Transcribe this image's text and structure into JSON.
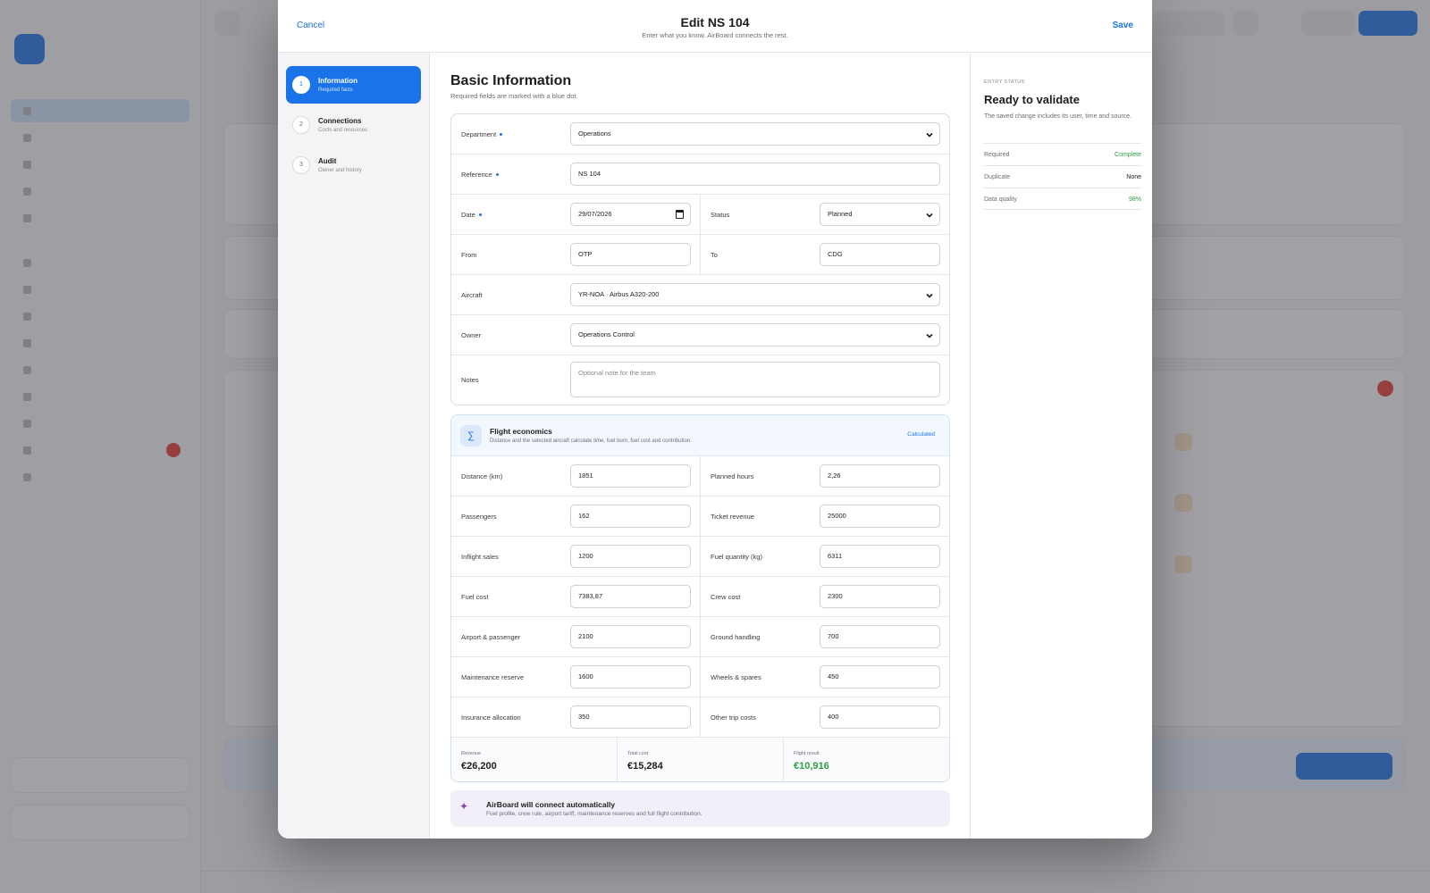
{
  "modal": {
    "cancel_label": "Cancel",
    "save_label": "Save",
    "title": "Edit NS 104",
    "subtitle": "Enter what you know. AirBoard connects the rest."
  },
  "steps": [
    {
      "number": "1",
      "label": "Information",
      "sub": "Required facts",
      "active": true
    },
    {
      "number": "2",
      "label": "Connections",
      "sub": "Costs and resources",
      "active": false
    },
    {
      "number": "3",
      "label": "Audit",
      "sub": "Owner and history",
      "active": false
    }
  ],
  "basic": {
    "title": "Basic Information",
    "subtitle": "Required fields are marked with a blue dot.",
    "department": {
      "label": "Department",
      "value": "Operations"
    },
    "reference": {
      "label": "Reference",
      "value": "NS 104"
    },
    "date": {
      "label": "Date",
      "value": "29/07/2026"
    },
    "status": {
      "label": "Status",
      "value": "Planned"
    },
    "from": {
      "label": "From",
      "value": "OTP"
    },
    "to": {
      "label": "To",
      "value": "CDG"
    },
    "aircraft": {
      "label": "Aircraft",
      "value": "YR-NOA · Airbus A320-200"
    },
    "owner": {
      "label": "Owner",
      "value": "Operations Control"
    },
    "notes": {
      "label": "Notes",
      "placeholder": "Optional note for the team"
    }
  },
  "economics": {
    "title": "Flight economics",
    "subtitle": "Distance and the selected aircraft calculate time, fuel burn, fuel cost and contribution.",
    "tag": "Calculated",
    "distance": {
      "label": "Distance (km)",
      "value": "1851"
    },
    "planned_hours": {
      "label": "Planned hours",
      "value": "2,26"
    },
    "passengers": {
      "label": "Passengers",
      "value": "162"
    },
    "ticket_revenue": {
      "label": "Ticket revenue",
      "value": "25000"
    },
    "inflight_sales": {
      "label": "Inflight sales",
      "value": "1200"
    },
    "fuel_quantity": {
      "label": "Fuel quantity (kg)",
      "value": "6311"
    },
    "fuel_cost": {
      "label": "Fuel cost",
      "value": "7383,87"
    },
    "crew_cost": {
      "label": "Crew cost",
      "value": "2300"
    },
    "airport_passenger": {
      "label": "Airport & passenger",
      "value": "2100"
    },
    "ground_handling": {
      "label": "Ground handling",
      "value": "700"
    },
    "maintenance_reserve": {
      "label": "Maintenance reserve",
      "value": "1600"
    },
    "wheels_spares": {
      "label": "Wheels & spares",
      "value": "450"
    },
    "insurance": {
      "label": "Insurance allocation",
      "value": "350"
    },
    "other_costs": {
      "label": "Other trip costs",
      "value": "400"
    },
    "revenue": {
      "label": "Revenue",
      "value": "€26,200"
    },
    "total_cost": {
      "label": "Total cost",
      "value": "€15,284"
    },
    "flight_result": {
      "label": "Flight result",
      "value": "€10,916"
    }
  },
  "auto_connect": {
    "title": "AirBoard will connect automatically",
    "subtitle": "Fuel profile, crew rule, airport tariff, maintenance reserves and full flight contribution."
  },
  "entry_status": {
    "eyebrow": "ENTRY STATUS",
    "title": "Ready to validate",
    "description": "The saved change includes its user, time and source.",
    "rows": [
      {
        "key": "Required",
        "value": "Complete"
      },
      {
        "key": "Duplicate",
        "value": "None"
      },
      {
        "key": "Data quality",
        "value": "98%"
      }
    ]
  },
  "colors": {
    "accent": "#1a73e8",
    "positive": "#2e9e44",
    "danger": "#e53935"
  }
}
